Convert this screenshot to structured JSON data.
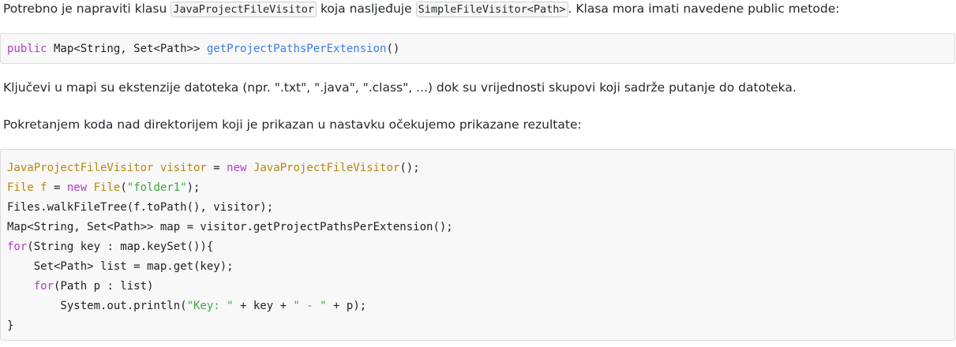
{
  "intro": {
    "part1": "Potrebno je napraviti klasu ",
    "class_name": "JavaProjectFileVisitor",
    "part2": " koja nasljeđuje ",
    "super_class": "SimpleFileVisitor<Path>",
    "part3": ". Klasa mora imati navedene public metode:"
  },
  "signature": {
    "keyword": "public",
    "return_type": " Map<String, Set<Path>> ",
    "method_name": "getProjectPathsPerExtension",
    "parens": "()"
  },
  "explanation": "Ključevi u mapi su ekstenzije datoteka (npr. \".txt\", \".java\", \".class\", ...) dok su vrijednosti skupovi koji sadrže putanje do datoteka.",
  "instruction": "Pokretanjem koda nad direktorijem koji je prikazan u nastavku očekujemo prikazane rezultate:",
  "code": {
    "l1": {
      "type": "JavaProjectFileVisitor visitor",
      "op": " = ",
      "kw": "new",
      "sp": " ",
      "ctor": "JavaProjectFileVisitor",
      "end": "();"
    },
    "l2": {
      "type": "File f",
      "op": " = ",
      "kw": "new",
      "sp": " ",
      "ctor": "File",
      "open": "(",
      "str": "\"folder1\"",
      "end": ");"
    },
    "l3": {
      "text": "Files.walkFileTree(f.toPath(), visitor);"
    },
    "l4": {
      "text": "Map<String, Set<Path>> map = visitor.getProjectPathsPerExtension();"
    },
    "l5": {
      "kw": "for",
      "rest": "(String key : map.keySet()){"
    },
    "l6": {
      "text": "    Set<Path> list = map.get(key);"
    },
    "l7": {
      "indent": "    ",
      "kw": "for",
      "rest": "(Path p : list)"
    },
    "l8": {
      "pre": "        System.out.println(",
      "s1": "\"Key: \"",
      "mid": " + key + ",
      "s2": "\" - \"",
      "post": " + p);"
    },
    "l9": {
      "text": "}"
    }
  }
}
